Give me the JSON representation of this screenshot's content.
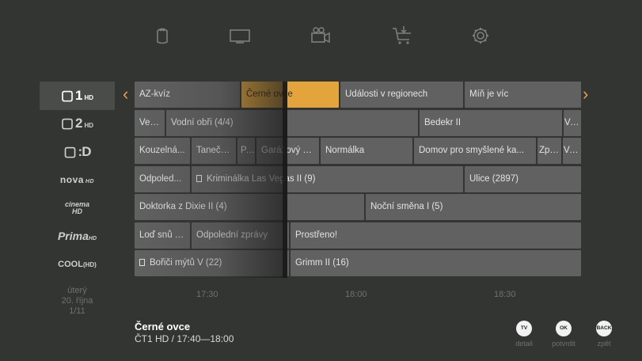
{
  "nav": {
    "icons": [
      "home-icon",
      "tv-icon",
      "video-camera-icon",
      "shopping-cart-icon",
      "gear-icon"
    ]
  },
  "channels": [
    {
      "id": "ct1hd",
      "name_main": "1",
      "name_suffix": "HD",
      "active": true
    },
    {
      "id": "ct2hd",
      "name_main": "2",
      "name_suffix": "HD",
      "active": false
    },
    {
      "id": "ctd",
      "name_main": ":D",
      "name_suffix": "",
      "active": false
    },
    {
      "id": "nova",
      "name_main": "nova",
      "name_suffix": "HD",
      "active": false
    },
    {
      "id": "novacinema",
      "name_main": "cinema",
      "name_suffix": "HD",
      "active": false
    },
    {
      "id": "prima",
      "name_main": "Prima",
      "name_suffix": "HD",
      "active": false
    },
    {
      "id": "primacool",
      "name_main": "COOL",
      "name_suffix": "HD",
      "active": false
    }
  ],
  "date": {
    "line1": "úterý",
    "line2": "20. října",
    "line3": "1/11"
  },
  "programs": [
    [
      {
        "title": "AZ-kvíz"
      },
      {
        "title": "Černé ovce",
        "selected": true
      },
      {
        "title": "Události v regionech"
      },
      {
        "title": "Míň je víc"
      }
    ],
    [
      {
        "title": "Vesmír"
      },
      {
        "title": "Vodní obři (4/4)"
      },
      {
        "title": "Bedekr II"
      },
      {
        "title": "Ve..."
      }
    ],
    [
      {
        "title": "Kouzelná..."
      },
      {
        "title": "Tanečn..."
      },
      {
        "title": "P..."
      },
      {
        "title": "Garážový k..."
      },
      {
        "title": "Normálka"
      },
      {
        "title": "Domov pro smyšlené ka..."
      },
      {
        "title": "Zpr..."
      },
      {
        "title": "Ve..."
      }
    ],
    [
      {
        "title": "Odpoled..."
      },
      {
        "title": "Kriminálka Las Vegas II (9)",
        "recording": true
      },
      {
        "title": "Ulice (2897)"
      }
    ],
    [
      {
        "title": "Doktorka z Dixie II (4)"
      },
      {
        "title": "Noční směna I (5)"
      }
    ],
    [
      {
        "title": "Loď snů (..."
      },
      {
        "title": "Odpolední zprávy"
      },
      {
        "title": "Prostřeno!"
      }
    ],
    [
      {
        "title": "Bořiči mýtů V (22)",
        "recording": true
      },
      {
        "title": "Grimm II (16)"
      }
    ]
  ],
  "timeline": [
    "17:30",
    "18:00",
    "18:30"
  ],
  "selected_info": {
    "title": "Černé ovce",
    "subtitle": "ČT1 HD / 17:40—18:00"
  },
  "hints": [
    {
      "key": "TV",
      "label": "detail"
    },
    {
      "key": "OK",
      "label": "potvrdit"
    },
    {
      "key": "BACK",
      "label": "zpět"
    }
  ],
  "colors": {
    "background": "#333533",
    "cell": "#616161",
    "accent": "#e3a43b"
  }
}
